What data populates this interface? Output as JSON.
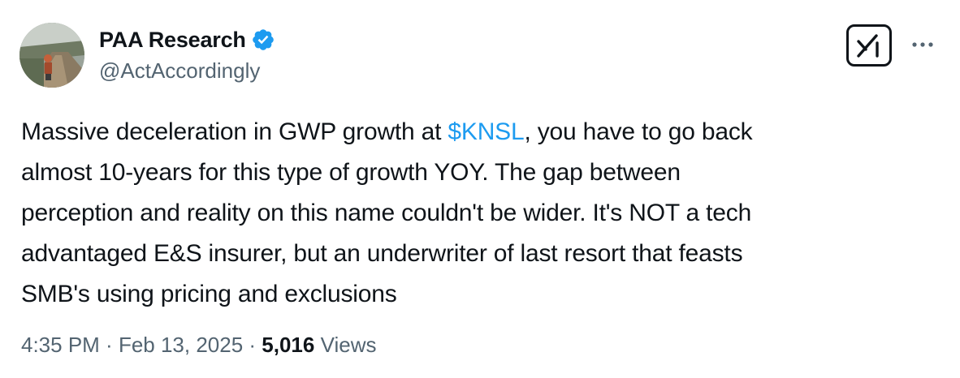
{
  "author": {
    "display_name": "PAA Research",
    "handle": "@ActAccordingly",
    "verified": true
  },
  "tweet": {
    "text_before": "Massive deceleration in GWP growth at ",
    "cashtag": "$KNSL",
    "line1_after": ", you have to go back",
    "line2": "almost 10-years for this type of growth YOY.  The gap between",
    "line3": "perception and reality on this name couldn't be wider. It's NOT a tech",
    "line4": "advantaged E&S insurer, but an underwriter of last resort that feasts",
    "line5": "SMB's using pricing and exclusions"
  },
  "meta": {
    "time": "4:35 PM",
    "sep1": " · ",
    "date": "Feb 13, 2025",
    "sep2": " · ",
    "views_count": "5,016",
    "views_label": " Views"
  },
  "icons": {
    "verified": "verified-badge-icon",
    "grok": "grok-icon",
    "more": "more-options-icon"
  },
  "colors": {
    "text": "#0f1419",
    "secondary": "#536471",
    "accent": "#1d9bf0"
  }
}
